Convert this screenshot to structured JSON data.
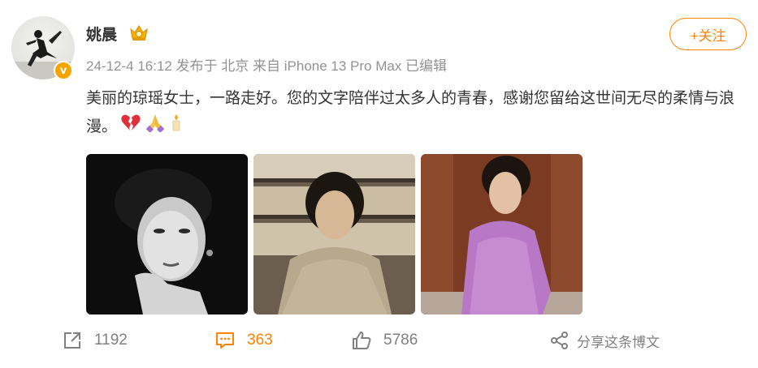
{
  "post": {
    "author": "姚晨",
    "verified_badge": "v",
    "meta": "24-12-4 16:12 发布于 北京 来自 iPhone 13 Pro Max 已编辑",
    "follow_label": "+关注",
    "text": "美丽的琼瑶女士，一路走好。您的文字陪伴过太多人的青春，感谢您留给这世间无尽的柔情与浪漫。",
    "emojis": [
      "broken-heart-icon",
      "praying-hands-icon",
      "candle-icon"
    ],
    "photos": [
      {
        "style": "black-and-white portrait"
      },
      {
        "style": "sepia portrait with bookshelf"
      },
      {
        "style": "color portrait in purple dress"
      }
    ]
  },
  "actions": {
    "repost_count": "1192",
    "comment_count": "363",
    "like_count": "5786",
    "share_label": "分享这条博文"
  },
  "colors": {
    "accent": "#ff8200",
    "meta_gray": "#939393",
    "action_gray": "#808080",
    "badge": "#f6a400"
  }
}
